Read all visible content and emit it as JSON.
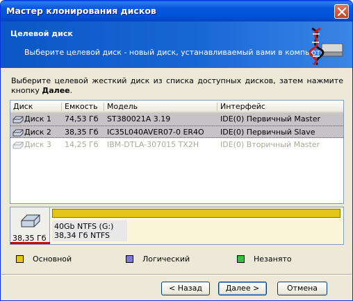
{
  "window": {
    "title": "Мастер клонирования дисков"
  },
  "header": {
    "title": "Целевой диск",
    "subtitle": "Выберите целевой диск - новый диск, устанавливаемый вами в компьютер."
  },
  "instruction": {
    "text": "Выберите целевой жесткий диск из списка доступных дисков, затем нажмите кнопку ",
    "bold": "Далее",
    "tail": "."
  },
  "table": {
    "columns": [
      "Диск",
      "Емкость",
      "Модель",
      "Интерфейс"
    ],
    "rows": [
      {
        "disk": "Диск 1",
        "capacity": "74,53 Гб",
        "model": "ST380021A 3.19",
        "interface": "IDE(0) Первичный Master",
        "state": "selected"
      },
      {
        "disk": "Диск 2",
        "capacity": "38,35 Гб",
        "model": "IC35L040AVER07-0 ER4O",
        "interface": "IDE(0) Первичный Slave",
        "state": "focused"
      },
      {
        "disk": "Диск 3",
        "capacity": "14,25 Гб",
        "model": "IBM-DTLA-307015 TX2H",
        "interface": "IDE(0) Вторичный Master",
        "state": "disabled"
      }
    ]
  },
  "diskmap": {
    "size": "38,35 Гб",
    "partition_label": "40Gb NTFS (G:)",
    "partition_detail": "38,34 Гб  NTFS"
  },
  "legend": {
    "primary": {
      "label": "Основной",
      "color": "#e3c418"
    },
    "logical": {
      "label": "Логический",
      "color": "#7b7bd6"
    },
    "free": {
      "label": "Незанято",
      "color": "#3cbc3c"
    }
  },
  "buttons": {
    "back": "< Назад",
    "next": "Далее >",
    "cancel": "Отмена"
  },
  "icons": {
    "close": "close-icon",
    "header": "dna-disk-icon",
    "disk": "hard-disk-icon"
  }
}
